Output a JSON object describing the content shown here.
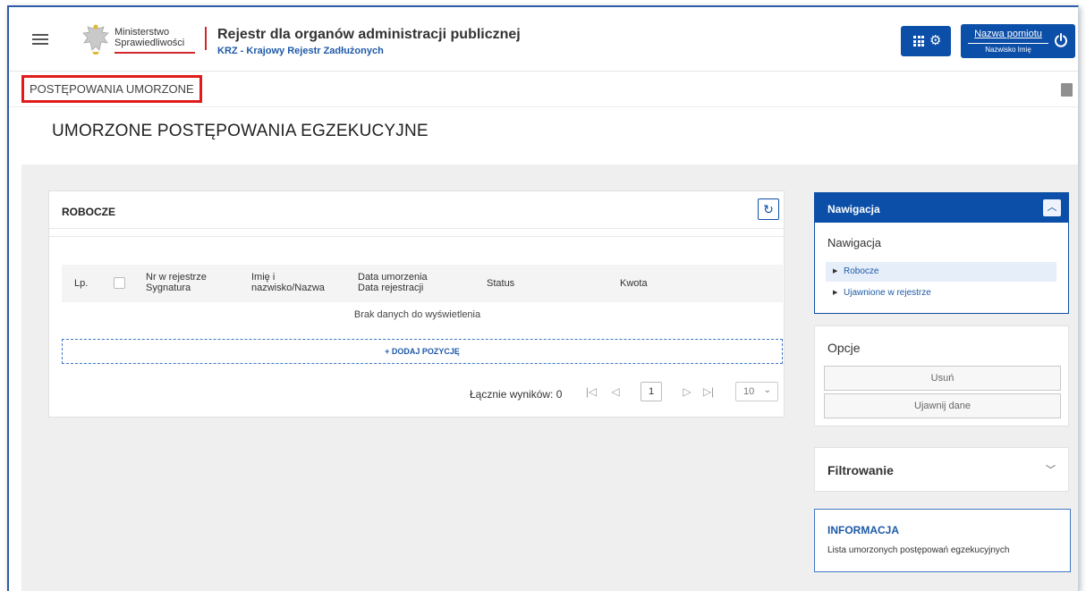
{
  "header": {
    "logo_line1": "Ministerstwo",
    "logo_line2": "Sprawiedliwości",
    "app_title": "Rejestr dla organów administracji publicznej",
    "app_subtitle": "KRZ - Krajowy Rejestr Zadłużonych",
    "user_name": "Nazwa pomiotu",
    "user_sub": "Nazwisko Imię",
    "icons": [
      "menu-icon",
      "grid-icon",
      "gear-icon",
      "power-icon"
    ]
  },
  "breadcrumb": {
    "label": "POSTĘPOWANIA UMORZONE"
  },
  "page": {
    "title": "UMORZONE POSTĘPOWANIA EGZEKUCYJNE"
  },
  "robocze": {
    "title": "ROBOCZE",
    "columns": {
      "lp": "Lp.",
      "nr_line1": "Nr w rejestrze",
      "nr_line2": "Sygnatura",
      "name_line1": "Imię i",
      "name_line2": "nazwisko/Nazwa",
      "date_line1": "Data umorzenia",
      "date_line2": "Data rejestracji",
      "status": "Status",
      "amount": "Kwota"
    },
    "no_data": "Brak danych do wyświetlenia",
    "add_label": "+ DODAJ POZYCJĘ",
    "pager": {
      "total_label": "Łącznie wyników: 0",
      "page": "1",
      "page_size": "10"
    }
  },
  "nav_panel": {
    "header": "Nawigacja",
    "subtitle": "Nawigacja",
    "items": [
      {
        "label": "Robocze",
        "active": true
      },
      {
        "label": "Ujawnione w rejestrze",
        "active": false
      }
    ]
  },
  "options_panel": {
    "title": "Opcje",
    "buttons": [
      "Usuń",
      "Ujawnij dane"
    ]
  },
  "filter_panel": {
    "title": "Filtrowanie"
  },
  "info_panel": {
    "title": "INFORMACJA",
    "text": "Lista umorzonych postępowań egzekucyjnych"
  },
  "colors": {
    "primary": "#0c4fa8",
    "accent_red": "#d0282c",
    "highlight": "#e01b1b"
  }
}
